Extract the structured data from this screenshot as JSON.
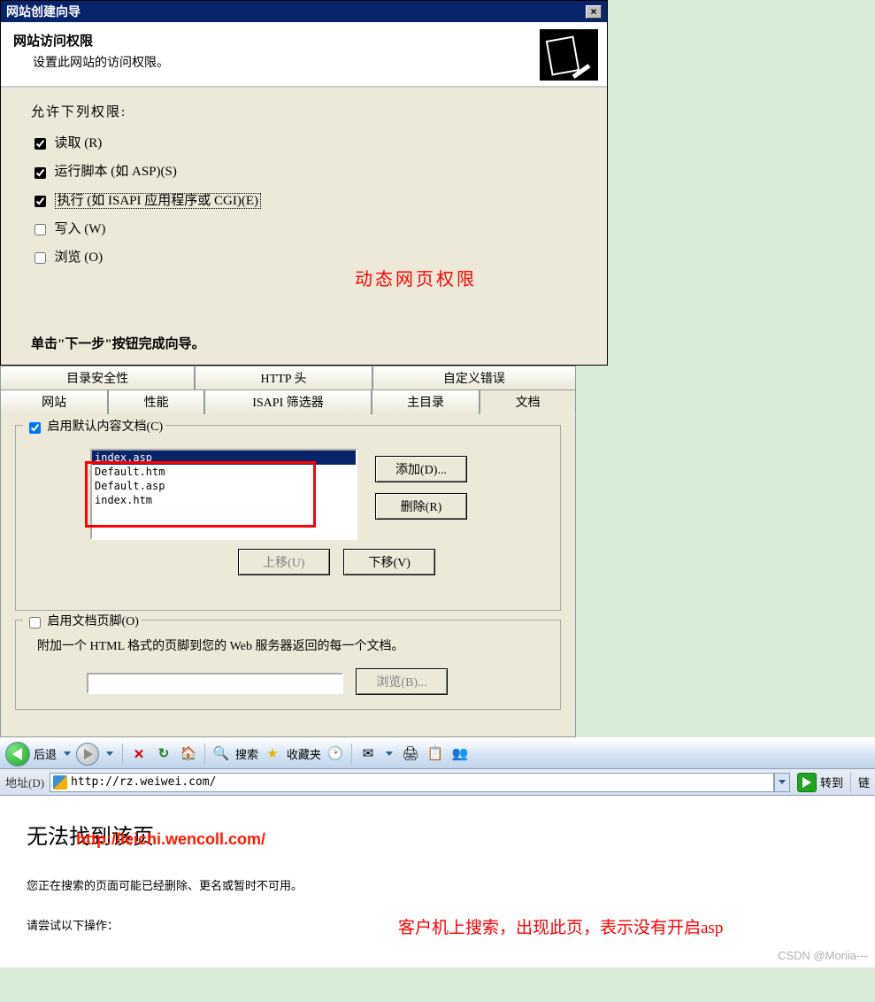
{
  "panel1": {
    "titlebar": "网站创建向导",
    "heading": "网站访问权限",
    "subheading": "设置此网站的访问权限。",
    "perm_title": "允许下列权限:",
    "perm_read": "读取 (R)",
    "perm_script": "运行脚本 (如 ASP)(S)",
    "perm_exec": "执行 (如 ISAPI 应用程序或 CGI)(E)",
    "perm_write": "写入 (W)",
    "perm_browse": "浏览 (O)",
    "anno": "动态网页权限",
    "footer": "单击\"下一步\"按钮完成向导。"
  },
  "panel2": {
    "tabs_row1": [
      "目录安全性",
      "HTTP 头",
      "自定义错误"
    ],
    "tabs_row2": [
      "网站",
      "性能",
      "ISAPI 筛选器",
      "主目录",
      "文档"
    ],
    "group1_legend": "启用默认内容文档(C)",
    "doc_items": [
      "index.asp",
      "Default.htm",
      "Default.asp",
      "index.htm"
    ],
    "btn_add": "添加(D)...",
    "btn_del": "删除(R)",
    "btn_up": "上移(U)",
    "btn_down": "下移(V)",
    "group2_legend": "启用文档页脚(O)",
    "group2_text": "附加一个 HTML 格式的页脚到您的 Web 服务器返回的每一个文档。",
    "btn_browse": "浏览(B)..."
  },
  "panel3": {
    "back": "后退",
    "search": "搜索",
    "fav": "收藏夹",
    "addr_lbl": "地址(D)",
    "url": "http://rz.weiwei.com/",
    "go": "转到",
    "overlay_url": "http://leichi.wencoll.com/",
    "err_h1": "无法找到该页",
    "err_p": "您正在搜索的页面可能已经删除、更名或暂时不可用。",
    "err_p2": "请尝试以下操作：",
    "anno": "客户机上搜索，出现此页，表示没有开启asp",
    "watermark": "CSDN @Moriia---"
  }
}
